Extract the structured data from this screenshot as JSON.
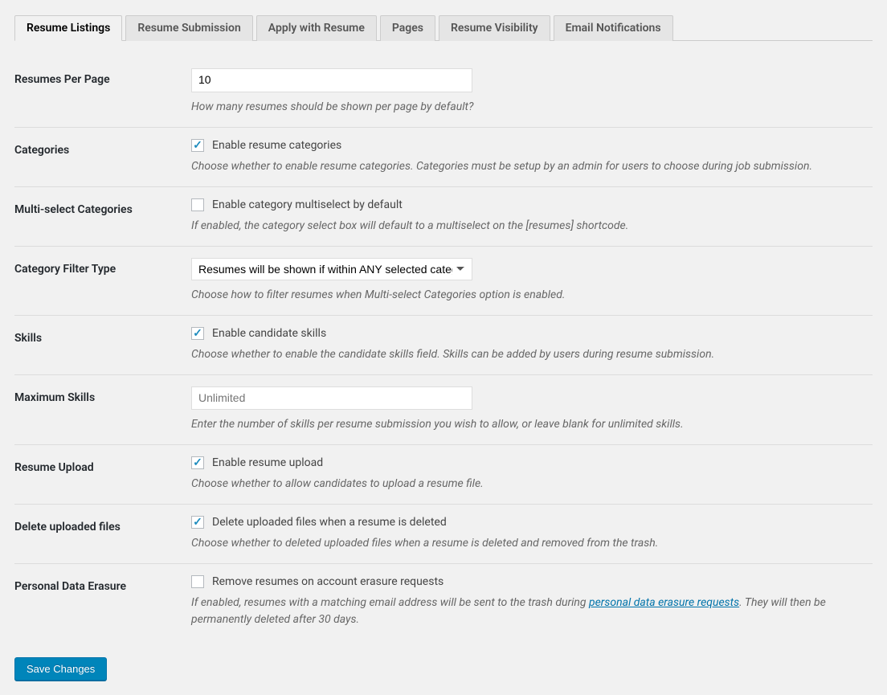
{
  "tabs": [
    {
      "label": "Resume Listings",
      "active": true
    },
    {
      "label": "Resume Submission",
      "active": false
    },
    {
      "label": "Apply with Resume",
      "active": false
    },
    {
      "label": "Pages",
      "active": false
    },
    {
      "label": "Resume Visibility",
      "active": false
    },
    {
      "label": "Email Notifications",
      "active": false
    }
  ],
  "fields": {
    "per_page": {
      "label": "Resumes Per Page",
      "value": "10",
      "desc": "How many resumes should be shown per page by default?"
    },
    "categories": {
      "label": "Categories",
      "checkbox_label": "Enable resume categories",
      "checked": true,
      "desc": "Choose whether to enable resume categories. Categories must be setup by an admin for users to choose during job submission."
    },
    "multiselect": {
      "label": "Multi-select Categories",
      "checkbox_label": "Enable category multiselect by default",
      "checked": false,
      "desc": "If enabled, the category select box will default to a multiselect on the [resumes] shortcode."
    },
    "filter_type": {
      "label": "Category Filter Type",
      "selected": "Resumes will be shown if within ANY selected category",
      "desc": "Choose how to filter resumes when Multi-select Categories option is enabled."
    },
    "skills": {
      "label": "Skills",
      "checkbox_label": "Enable candidate skills",
      "checked": true,
      "desc": "Choose whether to enable the candidate skills field. Skills can be added by users during resume submission."
    },
    "max_skills": {
      "label": "Maximum Skills",
      "value": "",
      "placeholder": "Unlimited",
      "desc": "Enter the number of skills per resume submission you wish to allow, or leave blank for unlimited skills."
    },
    "upload": {
      "label": "Resume Upload",
      "checkbox_label": "Enable resume upload",
      "checked": true,
      "desc": "Choose whether to allow candidates to upload a resume file."
    },
    "delete_files": {
      "label": "Delete uploaded files",
      "checkbox_label": "Delete uploaded files when a resume is deleted",
      "checked": true,
      "desc": "Choose whether to deleted uploaded files when a resume is deleted and removed from the trash."
    },
    "erasure": {
      "label": "Personal Data Erasure",
      "checkbox_label": "Remove resumes on account erasure requests",
      "checked": false,
      "desc_pre": "If enabled, resumes with a matching email address will be sent to the trash during ",
      "desc_link": "personal data erasure requests",
      "desc_post": ". They will then be permanently deleted after 30 days."
    }
  },
  "save_button": "Save Changes"
}
